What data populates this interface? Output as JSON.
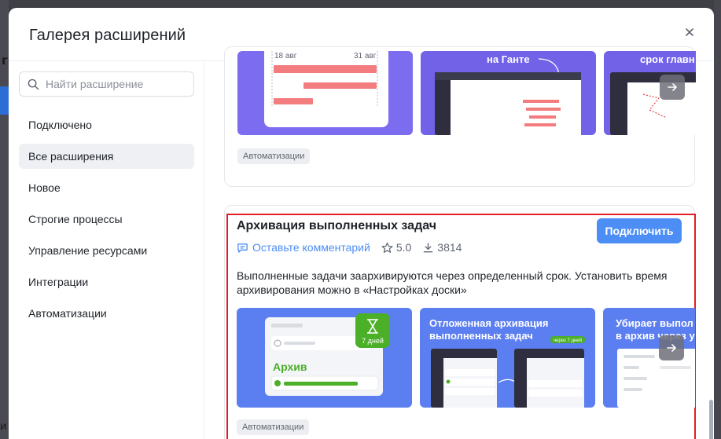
{
  "dialog": {
    "title": "Галерея расширений"
  },
  "background": {
    "left_letter": "г",
    "bottom_letter": "и"
  },
  "search": {
    "placeholder": "Найти расширение"
  },
  "sidebar": {
    "items": [
      {
        "label": "Подключено"
      },
      {
        "label": "Все расширения",
        "active": true
      },
      {
        "label": "Новое"
      },
      {
        "label": "Строгие процессы"
      },
      {
        "label": "Управление ресурсами"
      },
      {
        "label": "Интеграции"
      },
      {
        "label": "Автоматизации"
      }
    ]
  },
  "top_card": {
    "thumb1": {
      "date_left": "18 авг",
      "date_right": "31 авг"
    },
    "thumb2": {
      "caption": "на Ганте"
    },
    "thumb3": {
      "caption": "срок главн"
    },
    "tag": "Автоматизации"
  },
  "extension": {
    "title": "Архивация выполненных задач",
    "connect_label": "Подключить",
    "comment_label": "Оставьте комментарий",
    "rating": "5.0",
    "downloads": "3814",
    "description": "Выполненные задачи заархивируются через определенный срок. Установить время архивирования можно в «Настройках доски»",
    "tag": "Автоматизации",
    "thumb1": {
      "badge": "7 дней",
      "label": "Архив"
    },
    "thumb2": {
      "line1": "Отложенная архивация",
      "line2": "выполненных задач",
      "chip": "через 7 дней"
    },
    "thumb3": {
      "line1": "Убирает выпол",
      "line2": "в архив через у"
    }
  },
  "colors": {
    "accent": "#4c8ef5",
    "purple": "#7b6cf0",
    "blue_thumb": "#5b7ef0",
    "highlight": "#e01e26",
    "salmon": "#f37c7f",
    "green": "#4caf28"
  }
}
